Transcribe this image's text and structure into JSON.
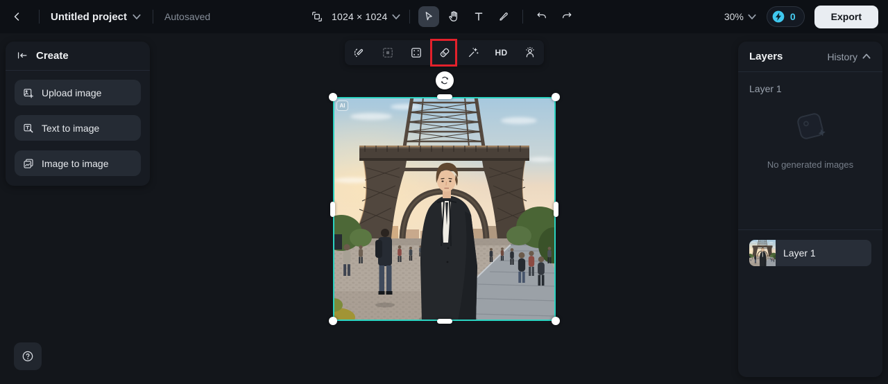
{
  "topbar": {
    "project_name": "Untitled project",
    "autosave_status": "Autosaved",
    "canvas_size": "1024 × 1024",
    "zoom_level": "30%",
    "credits_count": "0",
    "export_label": "Export"
  },
  "create_panel": {
    "title": "Create",
    "buttons": [
      {
        "label": "Upload image"
      },
      {
        "label": "Text to image"
      },
      {
        "label": "Image to image"
      }
    ]
  },
  "canvas_toolbar": {
    "hd_label": "HD",
    "highlighted_tool": "eraser",
    "highlight_color": "#e3212b"
  },
  "canvas": {
    "ai_badge": "AI",
    "selection_color": "#2bd3c1",
    "image_description": "Man in a dark coat standing on a cobblestone plaza in front of the Eiffel Tower at dusk with pedestrians around"
  },
  "layers_panel": {
    "layers_tab": "Layers",
    "history_tab": "History",
    "group_label": "Layer 1",
    "empty_state": "No generated images",
    "layer_item_label": "Layer 1"
  }
}
